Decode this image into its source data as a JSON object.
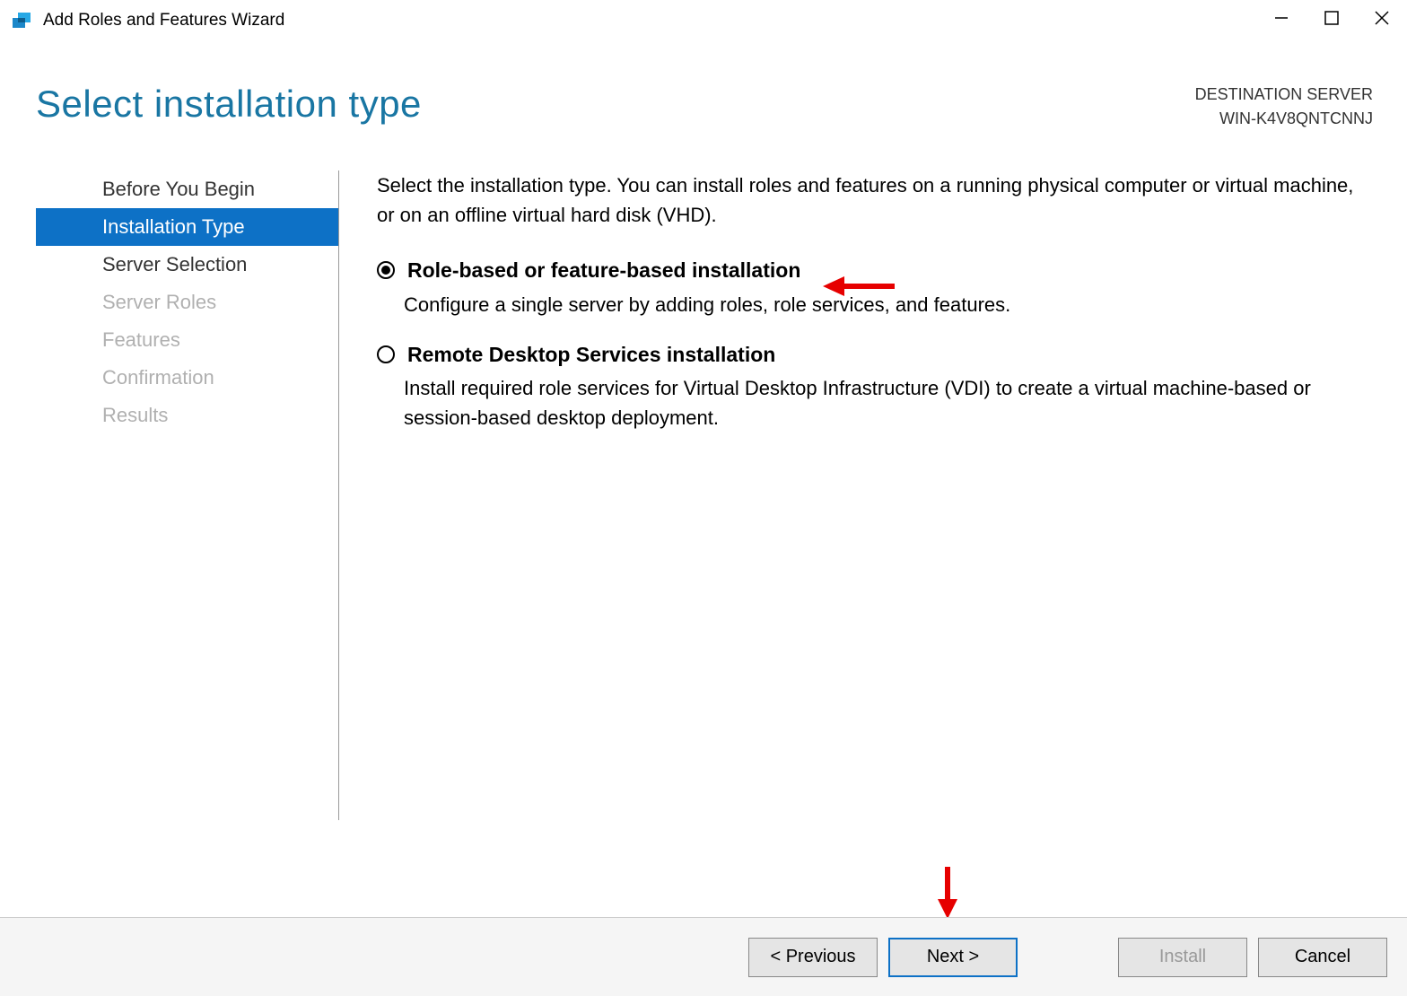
{
  "titlebar": {
    "title": "Add Roles and Features Wizard"
  },
  "header": {
    "page_title": "Select installation type",
    "dest_label": "DESTINATION SERVER",
    "dest_server": "WIN-K4V8QNTCNNJ"
  },
  "sidebar": {
    "items": [
      {
        "label": "Before You Begin",
        "state": "normal"
      },
      {
        "label": "Installation Type",
        "state": "active"
      },
      {
        "label": "Server Selection",
        "state": "normal"
      },
      {
        "label": "Server Roles",
        "state": "disabled"
      },
      {
        "label": "Features",
        "state": "disabled"
      },
      {
        "label": "Confirmation",
        "state": "disabled"
      },
      {
        "label": "Results",
        "state": "disabled"
      }
    ]
  },
  "content": {
    "intro": "Select the installation type. You can install roles and features on a running physical computer or virtual machine, or on an offline virtual hard disk (VHD).",
    "options": [
      {
        "label": "Role-based or feature-based installation",
        "desc": "Configure a single server by adding roles, role services, and features.",
        "selected": true
      },
      {
        "label": "Remote Desktop Services installation",
        "desc": "Install required role services for Virtual Desktop Infrastructure (VDI) to create a virtual machine-based or session-based desktop deployment.",
        "selected": false
      }
    ]
  },
  "footer": {
    "previous": "< Previous",
    "next": "Next >",
    "install": "Install",
    "cancel": "Cancel"
  }
}
